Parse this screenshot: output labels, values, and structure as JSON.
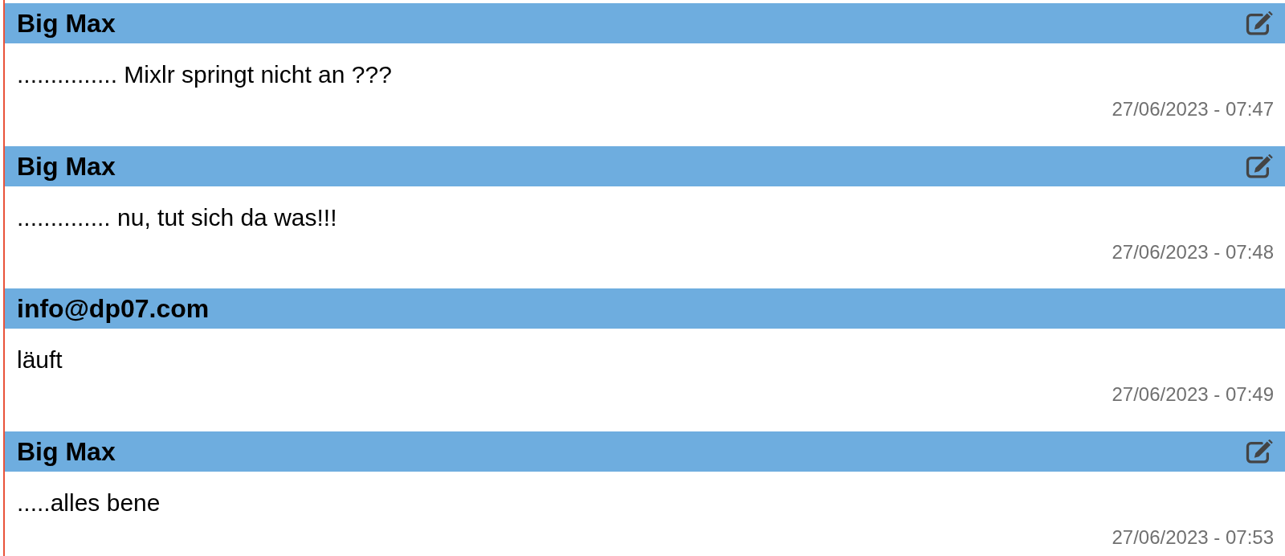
{
  "messages": [
    {
      "author": "Big Max",
      "editable": true,
      "text": "............... Mixlr springt nicht an ???",
      "timestamp": "27/06/2023 - 07:47"
    },
    {
      "author": "Big Max",
      "editable": true,
      "text": ".............. nu, tut sich da was!!!",
      "timestamp": "27/06/2023 - 07:48"
    },
    {
      "author": "info@dp07.com",
      "editable": false,
      "text": "läuft",
      "timestamp": "27/06/2023 - 07:49"
    },
    {
      "author": "Big Max",
      "editable": true,
      "text": ".....alles bene",
      "timestamp": "27/06/2023 - 07:53"
    }
  ]
}
